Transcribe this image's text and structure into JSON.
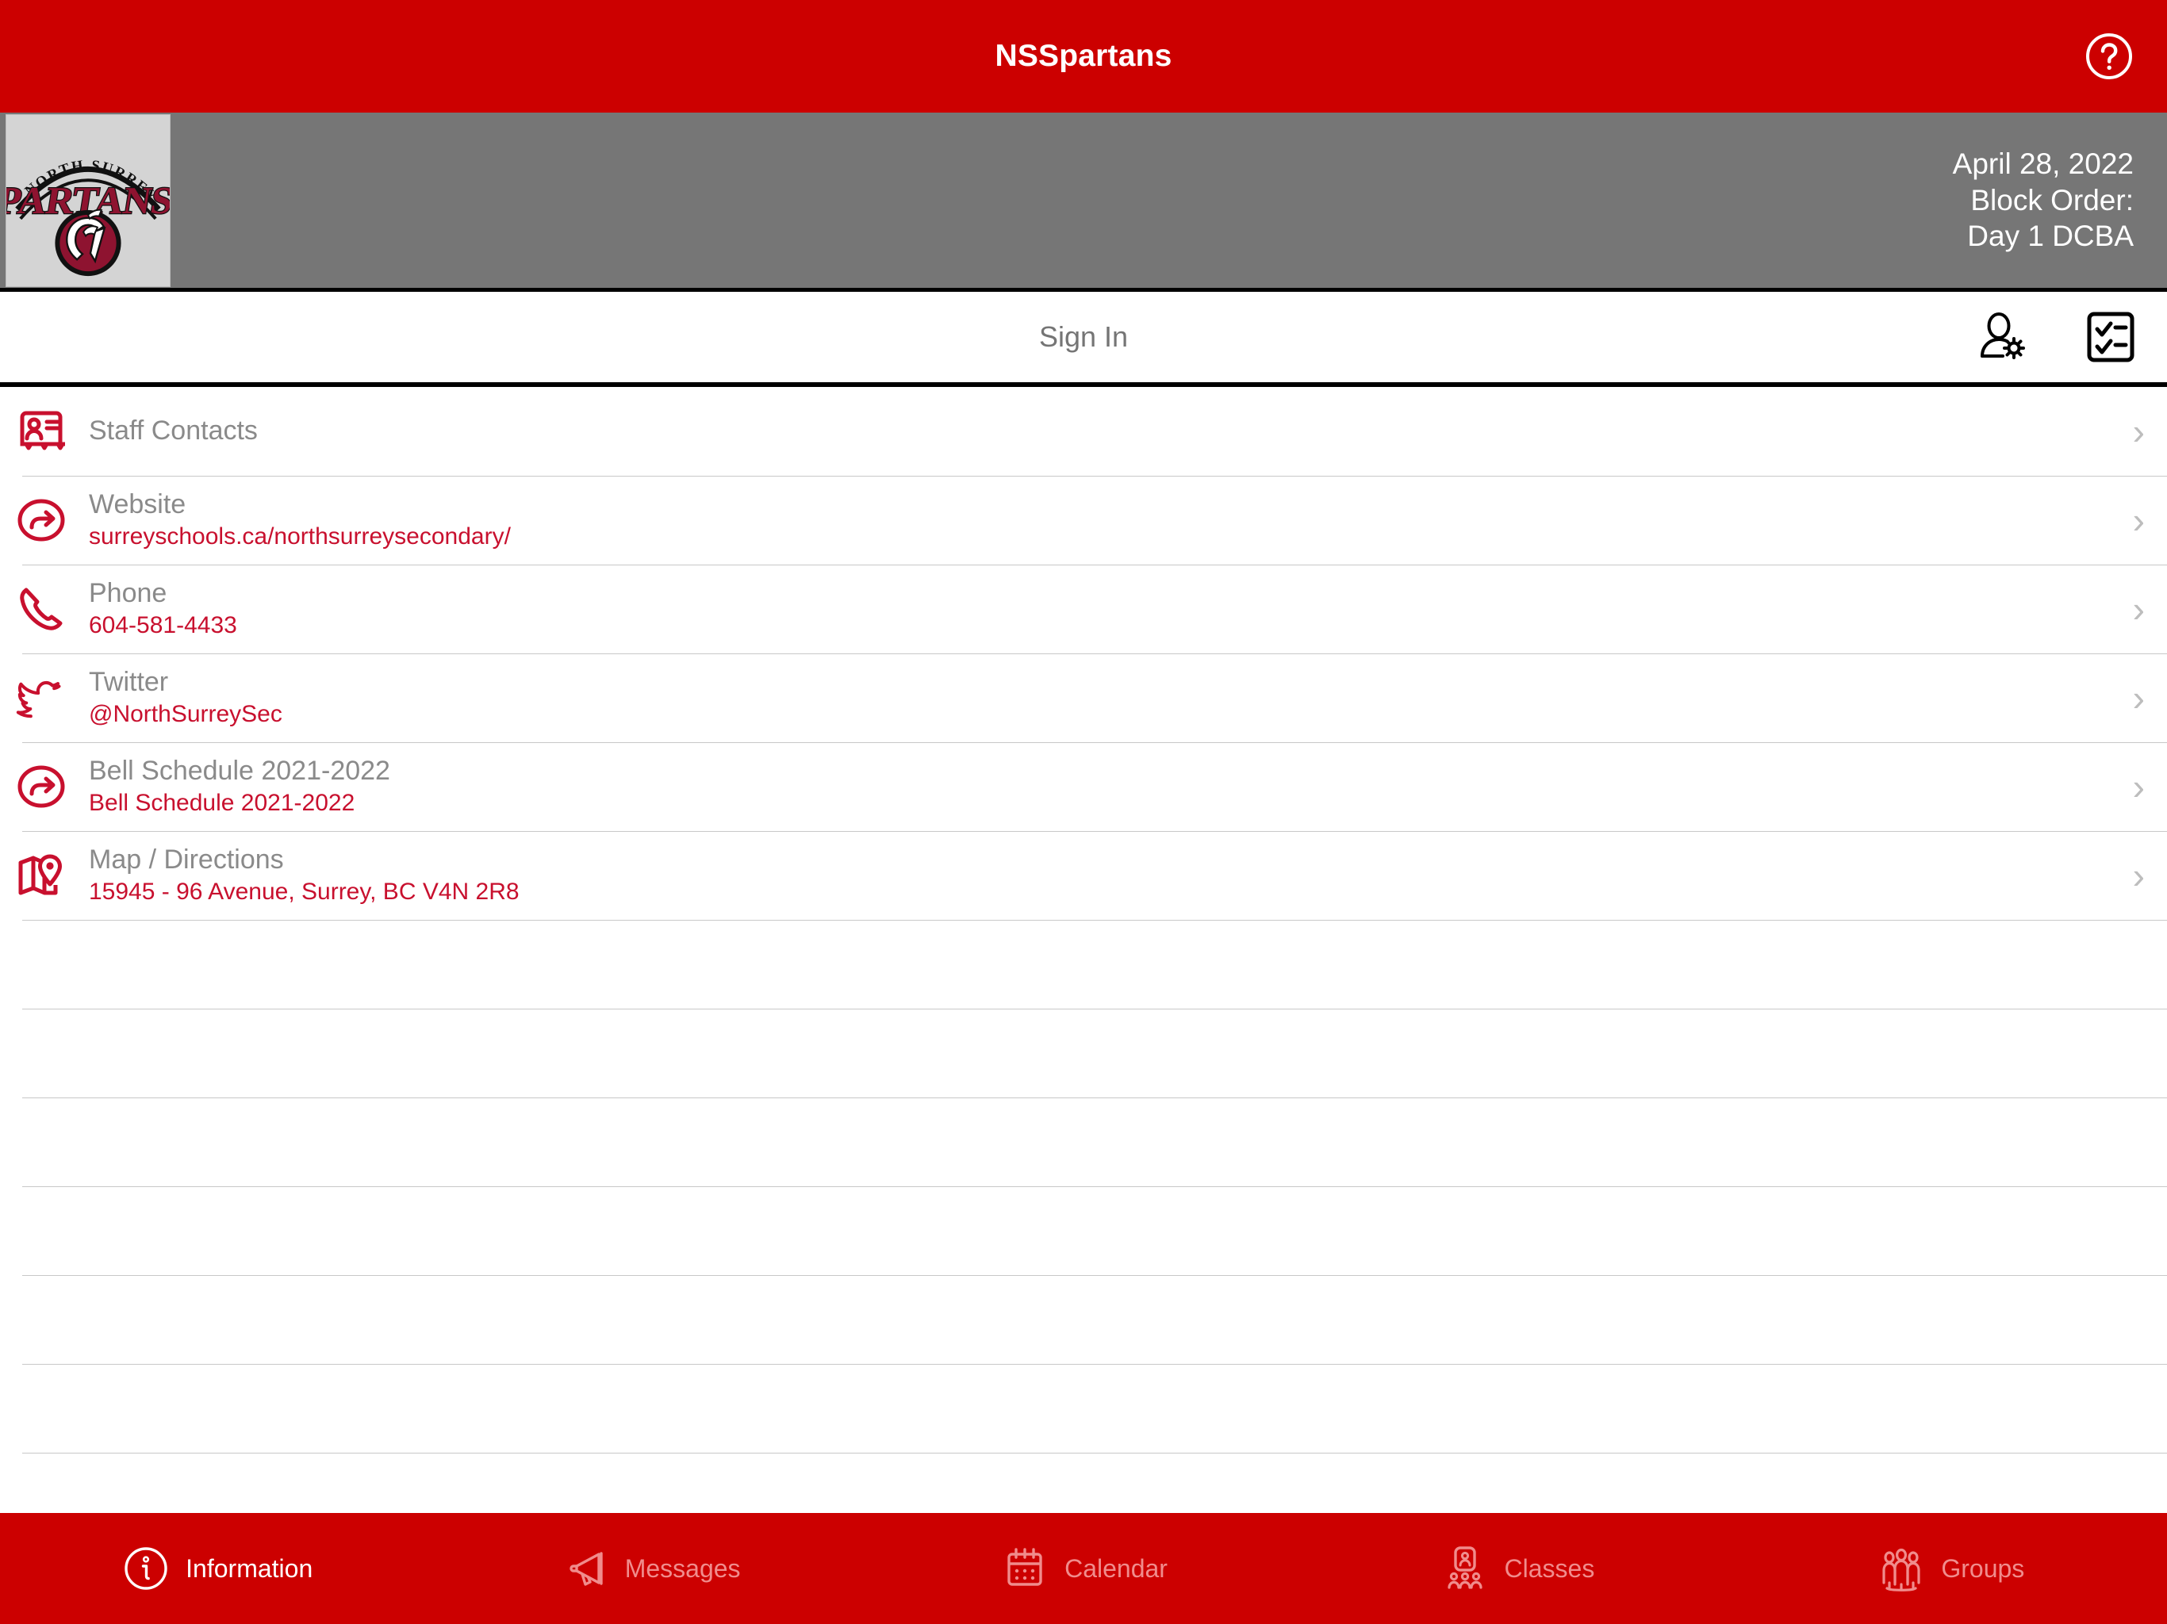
{
  "titlebar": {
    "title": "NSSpartans",
    "help_icon": "help-circle-icon",
    "background": "#cc0000"
  },
  "banner": {
    "logo": {
      "icon": "school-logo",
      "arc_text": "NORTH SURREY",
      "main_text": "SPARTANS",
      "mascot": "spartan-helmet"
    },
    "date": "April 28, 2022",
    "block_order_label": "Block Order:",
    "block_order_value": "Day 1 DCBA",
    "background": "#767676"
  },
  "signin_bar": {
    "label": "Sign In",
    "icons": [
      {
        "name": "user-settings-icon"
      },
      {
        "name": "checklist-icon"
      }
    ]
  },
  "list": {
    "chevron": "›",
    "items": [
      {
        "icon": "contact-card-icon",
        "label": "Staff Contacts",
        "value": ""
      },
      {
        "icon": "external-link-icon",
        "label": "Website",
        "value": "surreyschools.ca/northsurreysecondary/"
      },
      {
        "icon": "phone-icon",
        "label": "Phone",
        "value": "604-581-4433"
      },
      {
        "icon": "twitter-bird-icon",
        "label": "Twitter",
        "value": "@NorthSurreySec"
      },
      {
        "icon": "external-link-icon",
        "label": "Bell Schedule 2021-2022",
        "value": "Bell Schedule 2021-2022"
      },
      {
        "icon": "map-pin-icon",
        "label": "Map / Directions",
        "value": "15945 - 96 Avenue, Surrey, BC V4N 2R8"
      }
    ],
    "empty_row_count": 6,
    "label_color": "#8a8a8a",
    "value_color": "#c8102e"
  },
  "tabbar": {
    "background": "#cc0000",
    "active_color": "#ffffff",
    "inactive_color": "#f08c8c",
    "tabs": [
      {
        "icon": "info-circle-icon",
        "label": "Information",
        "active": true
      },
      {
        "icon": "megaphone-icon",
        "label": "Messages",
        "active": false
      },
      {
        "icon": "calendar-icon",
        "label": "Calendar",
        "active": false
      },
      {
        "icon": "classes-icon",
        "label": "Classes",
        "active": false
      },
      {
        "icon": "groups-icon",
        "label": "Groups",
        "active": false
      }
    ]
  }
}
